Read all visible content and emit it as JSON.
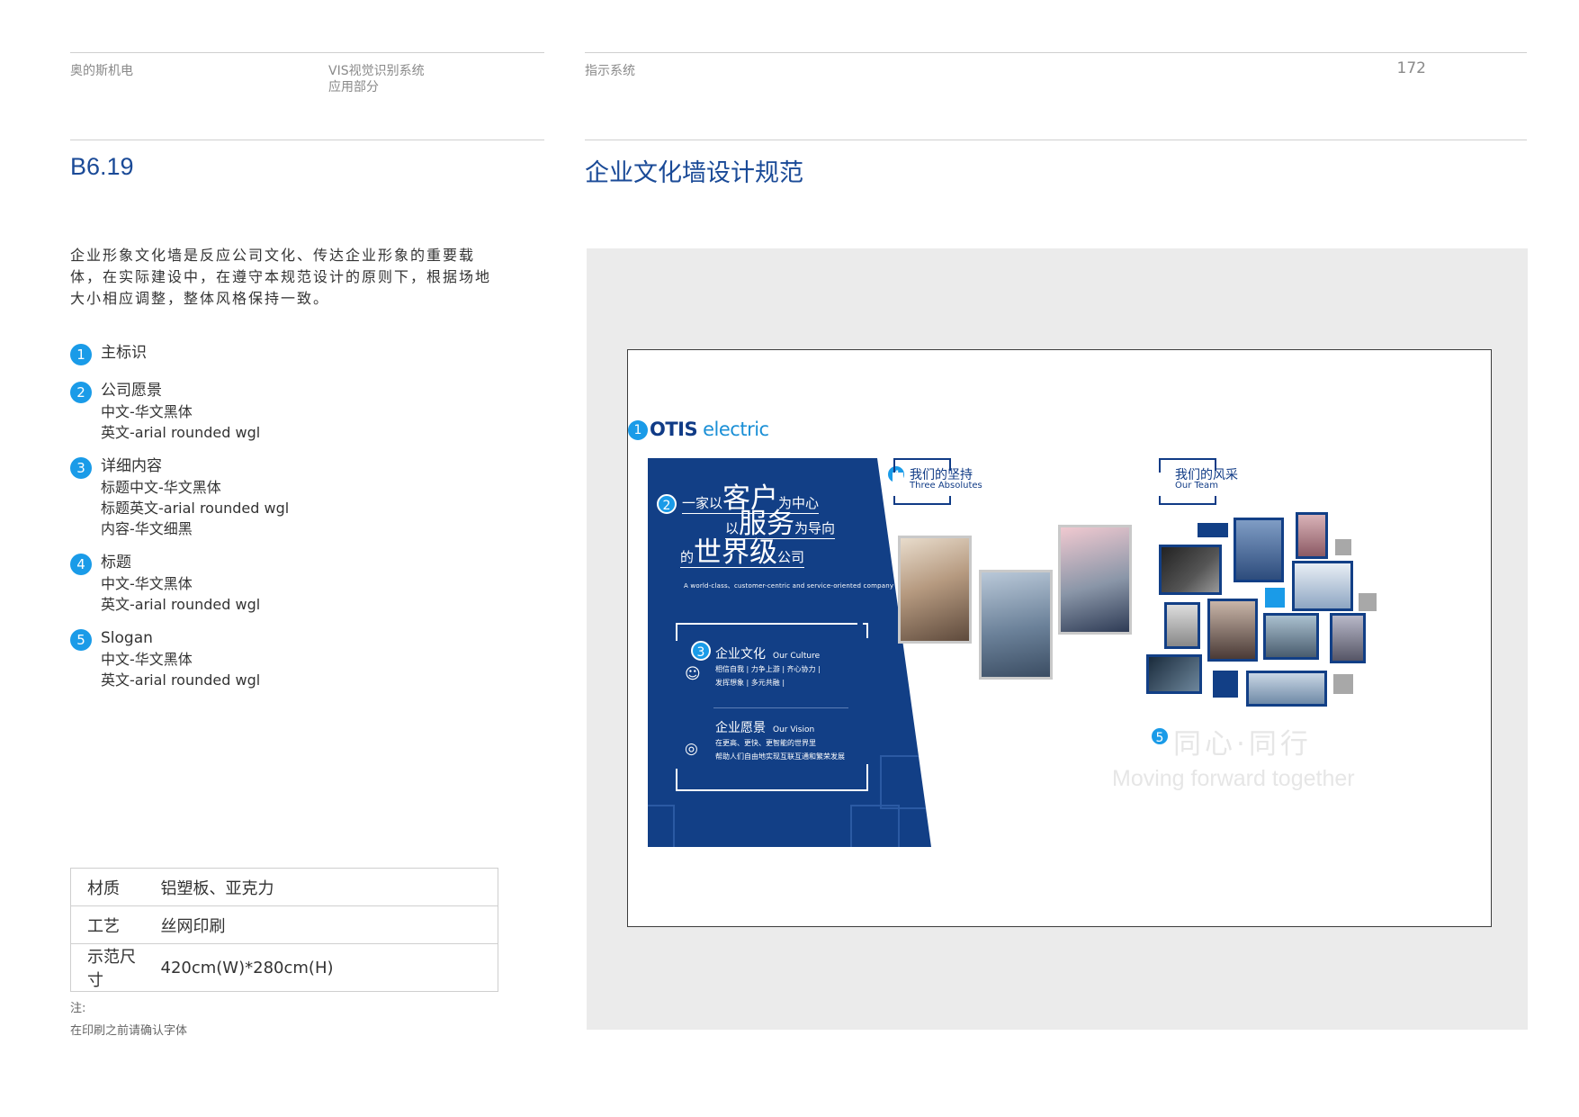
{
  "header": {
    "brand": "奥的斯机电",
    "doc_title_1": "VIS视觉识别系统",
    "doc_title_2": "应用部分",
    "section": "指示系统",
    "page_number": "172"
  },
  "section_code": "B6.19",
  "section_title": "企业文化墙设计规范",
  "intro": "企业形象文化墙是反应公司文化、传达企业形象的重要载体，在实际建设中，在遵守本规范设计的原则下，根据场地大小相应调整，整体风格保持一致。",
  "legend": [
    {
      "num": "1",
      "title": "主标识",
      "lines": []
    },
    {
      "num": "2",
      "title": "公司愿景",
      "lines": [
        "中文-华文黑体",
        "英文-arial rounded wgl"
      ]
    },
    {
      "num": "3",
      "title": "详细内容",
      "lines": [
        "标题中文-华文黑体",
        "标题英文-arial rounded wgl",
        "内容-华文细黑"
      ]
    },
    {
      "num": "4",
      "title": "标题",
      "lines": [
        "中文-华文黑体",
        "英文-arial rounded wgl"
      ]
    },
    {
      "num": "5",
      "title": "Slogan",
      "lines": [
        "中文-华文黑体",
        "英文-arial rounded wgl"
      ]
    }
  ],
  "spec_table": [
    {
      "key": "材质",
      "value": "铝塑板、亚克力"
    },
    {
      "key": "工艺",
      "value": "丝网印刷"
    },
    {
      "key": "示范尺寸",
      "value": "420cm(W)*280cm(H)"
    }
  ],
  "note": {
    "label": "注:",
    "text": "在印刷之前请确认字体"
  },
  "wall": {
    "colors": {
      "navy": "#123f86",
      "accent": "#1a9be8",
      "gray": "#a8a8a8"
    },
    "logo": {
      "badge": "1",
      "brand": "OTIS",
      "suffix": "electric"
    },
    "vision": {
      "badge": "2",
      "line1_pre": "一家以",
      "line1_big": "客户",
      "line1_post": "为中心",
      "line2_pre": "以",
      "line2_big": "服务",
      "line2_post": "为导向",
      "line3_pre": "的",
      "line3_big": "世界级",
      "line3_post": "公司",
      "english": "A world-class、customer-centric and service-oriented company"
    },
    "culture": {
      "badge": "3",
      "title": "企业文化",
      "title_en": "Our Culture",
      "text_1": "相信自我 | 力争上游 | 齐心协力 |",
      "text_2": "发挥想象 | 多元共融 |",
      "vision_title": "企业愿景",
      "vision_title_en": "Our Vision",
      "vision_text_1": "在更高、更快、更智能的世界里",
      "vision_text_2": "帮助人们自由地实现互联互通和繁荣发展",
      "culture_icon": "people-icon",
      "vision_icon": "target-icon"
    },
    "absolutes": {
      "badge": "4",
      "cn": "我们的坚持",
      "en": "Three Absolutes"
    },
    "team": {
      "cn": "我们的风采",
      "en": "Our Team"
    },
    "slogan": {
      "badge": "5",
      "cn": "同心·同行",
      "en": "Moving forward together"
    }
  }
}
